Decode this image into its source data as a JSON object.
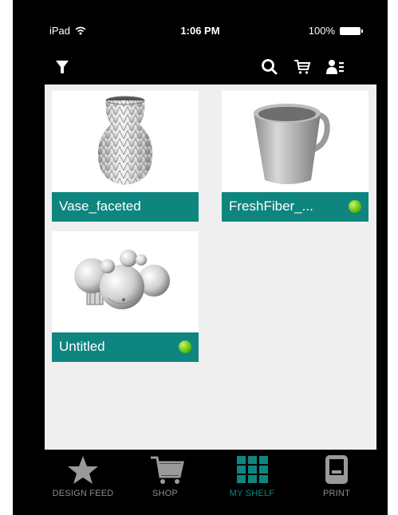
{
  "status_bar": {
    "device": "iPad",
    "time": "1:06 PM",
    "battery": "100%"
  },
  "toolbar": {
    "icons": [
      "filter-icon",
      "search-icon",
      "cart-icon",
      "account-icon"
    ]
  },
  "shelf": {
    "items": [
      {
        "name": "Vase_faceted",
        "status_dot": false
      },
      {
        "name": "FreshFiber_...",
        "status_dot": true
      },
      {
        "name": "Untitled",
        "status_dot": true
      }
    ]
  },
  "tabs": [
    {
      "label": "DESIGN FEED",
      "icon": "star-icon",
      "active": false
    },
    {
      "label": "SHOP",
      "icon": "cart-icon",
      "active": false
    },
    {
      "label": "MY SHELF",
      "icon": "grid-icon",
      "active": true
    },
    {
      "label": "PRINT",
      "icon": "printer-icon",
      "active": false
    }
  ],
  "colors": {
    "accent": "#0f857f",
    "status_dot": "#5fbf11",
    "background": "#000000",
    "content_bg": "#efefef",
    "inactive_tab": "#8c8c8c"
  }
}
